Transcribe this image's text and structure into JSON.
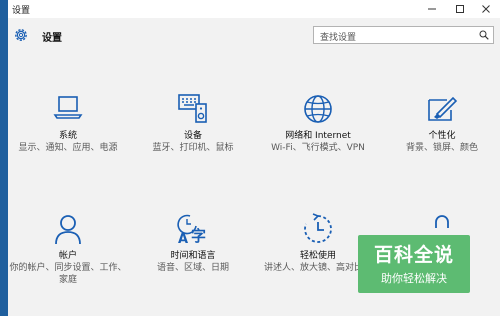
{
  "window": {
    "title": "设置"
  },
  "header": {
    "title": "设置",
    "search_placeholder": "查找设置"
  },
  "tiles": [
    {
      "label": "系统",
      "desc": "显示、通知、应用、电源"
    },
    {
      "label": "设备",
      "desc": "蓝牙、打印机、鼠标"
    },
    {
      "label": "网络和 Internet",
      "desc": "Wi-Fi、飞行模式、VPN"
    },
    {
      "label": "个性化",
      "desc": "背景、锁屏、颜色"
    },
    {
      "label": "帐户",
      "desc": "你的帐户、同步设置、工作、家庭"
    },
    {
      "label": "时间和语言",
      "desc": "语音、区域、日期"
    },
    {
      "label": "轻松使用",
      "desc": "讲述人、放大镜、高对比度"
    }
  ],
  "watermark": {
    "title": "百科全说",
    "subtitle": "助你轻松解决"
  },
  "colors": {
    "accent": "#1a5fb4",
    "watermark": "#5dbb72"
  }
}
